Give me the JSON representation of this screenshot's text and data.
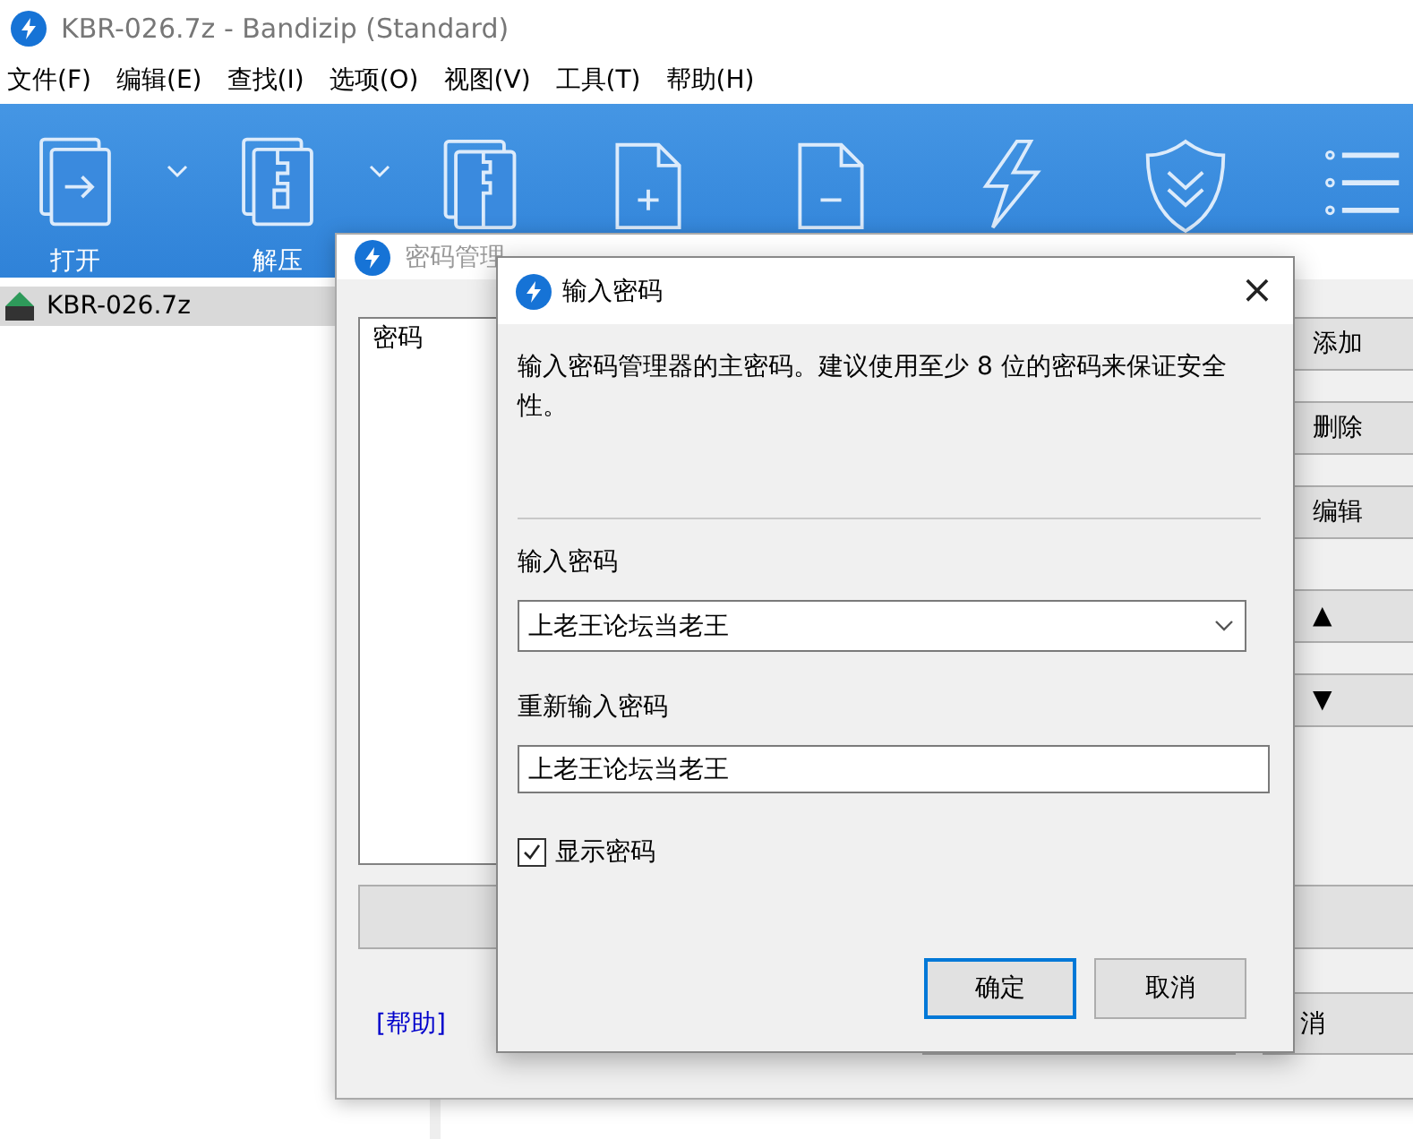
{
  "window": {
    "title": "KBR-026.7z - Bandizip (Standard)"
  },
  "menu": [
    "文件(F)",
    "编辑(E)",
    "查找(I)",
    "选项(O)",
    "视图(V)",
    "工具(T)",
    "帮助(H)"
  ],
  "toolbar": [
    {
      "label": "打开",
      "dropdown": true
    },
    {
      "label": "解压",
      "dropdown": true
    }
  ],
  "file_list": [
    {
      "name": "KBR-026.7z",
      "selected": true
    }
  ],
  "password_manager": {
    "title": "密码管理",
    "list_header": "密码",
    "side_buttons": [
      "添加",
      "删除",
      "编辑",
      "▲",
      "▼"
    ],
    "help_link": "[帮助]",
    "cancel_button": "消"
  },
  "dialog": {
    "title": "输入密码",
    "close": "×",
    "description": "输入密码管理器的主密码。建议使用至少 8 位的密码来保证安全性。",
    "password_label": "输入密码",
    "password_value": "上老王论坛当老王",
    "confirm_label": "重新输入密码",
    "confirm_value": "上老王论坛当老王",
    "show_password": {
      "label": "显示密码",
      "checked": true
    },
    "buttons": [
      {
        "label": "确定",
        "default": true
      },
      {
        "label": "取消",
        "default": false
      }
    ]
  }
}
